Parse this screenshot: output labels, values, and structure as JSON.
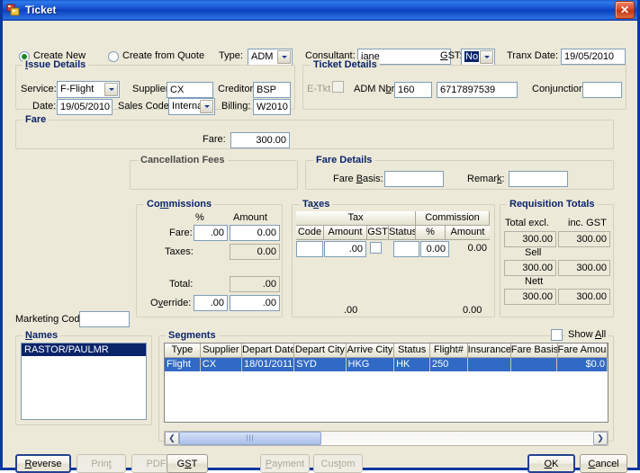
{
  "window": {
    "title": "Ticket",
    "icon": "ticket-icon",
    "close_label": "✕",
    "accent": "#0A37A0",
    "face": "#ECE9D8",
    "group_title_color": "#0A246A",
    "selection_color": "#316AC5"
  },
  "top": {
    "create_new": "Create New",
    "create_from_quote": "Create from Quote",
    "type_label": "Type:",
    "type_value": "ADM",
    "consultant_label": "Consultant:",
    "consultant_value": "jane",
    "gst_label": "GST:",
    "gst_value": "No",
    "tranx_date_label": "Tranx Date:",
    "tranx_date_value": "19/05/2010"
  },
  "issue_details": {
    "title": "Issue Details",
    "service_label": "Service:",
    "service_value": "F-Flight",
    "supplier_label": "Supplier:",
    "supplier_value": "CX",
    "creditor_label": "Creditor:",
    "creditor_value": "BSP",
    "date_label": "Date:",
    "date_value": "19/05/2010",
    "sales_code_label": "Sales Code:",
    "sales_code_value": "Internat",
    "billing_label": "Billing:",
    "billing_value": "W2010"
  },
  "ticket_details": {
    "title": "Ticket Details",
    "etkt_label": "E-Tkt",
    "etkt_checked": false,
    "adm_nbr_label": "ADM Nbr:",
    "adm_nbr_value": "160",
    "adm_nbr_value2": "6717897539",
    "conjunction_label": "Conjunction:",
    "conjunction_value": ""
  },
  "fare": {
    "title": "Fare",
    "fare_label": "Fare:",
    "fare_value": "300.00"
  },
  "cancellation_fees": {
    "title": "Cancellation Fees"
  },
  "fare_details": {
    "title": "Fare Details",
    "fare_basis_label": "Fare Basis:",
    "fare_basis_value": "",
    "remark_label": "Remark:",
    "remark_value": ""
  },
  "commissions": {
    "title": "Commissions",
    "col_pct": "%",
    "col_amount": "Amount",
    "fare_label": "Fare:",
    "fare_pct": ".00",
    "fare_amount": "0.00",
    "taxes_label": "Taxes:",
    "taxes_amount": "0.00",
    "total_label": "Total:",
    "total_amount": ".00",
    "override_label": "Override:",
    "override_pct": ".00",
    "override_amount": ".00"
  },
  "taxes": {
    "title": "Taxes",
    "group_tax": "Tax",
    "group_commission": "Commission",
    "col_code": "Code",
    "col_amount": "Amount",
    "col_gst": "GST",
    "col_status": "Status",
    "col_pct": "%",
    "col_comm_amount": "Amount",
    "row": {
      "code": "",
      "amount": ".00",
      "gst_checked": false,
      "status": "",
      "pct": "0.00",
      "comm_amount": "0.00"
    },
    "total_amount": ".00",
    "total_comm": "0.00"
  },
  "requisition_totals": {
    "title": "Requisition Totals",
    "col_excl": "Total excl.",
    "col_inc_gst": "inc. GST",
    "total_excl": "300.00",
    "total_inc": "300.00",
    "sell_label": "Sell",
    "sell_excl": "300.00",
    "sell_inc": "300.00",
    "nett_label": "Nett",
    "nett_excl": "300.00",
    "nett_inc": "300.00"
  },
  "marketing": {
    "label": "Marketing Code:",
    "value": ""
  },
  "names": {
    "title": "Names",
    "items": [
      {
        "text": "RASTOR/PAULMR",
        "selected": true
      }
    ]
  },
  "segments": {
    "title": "Segments",
    "show_all_label": "Show All",
    "show_all_checked": false,
    "columns": [
      "Type",
      "Supplier",
      "Depart Date",
      "Depart City",
      "Arrive City",
      "Status",
      "Flight#",
      "Insurance",
      "Fare Basis",
      "Fare Amount"
    ],
    "rows": [
      {
        "selected": true,
        "cells": [
          "Flight",
          "CX",
          "18/01/2011",
          "SYD",
          "HKG",
          "HK",
          "250",
          "",
          "",
          "$0.0"
        ]
      }
    ],
    "scroll_left_icon": "chevron-left-icon",
    "scroll_right_icon": "chevron-right-icon"
  },
  "buttons": {
    "reverse": {
      "label": "Reverse",
      "enabled": true,
      "default": true
    },
    "print": {
      "label": "Print",
      "enabled": false
    },
    "pdf": {
      "label": "PDF",
      "enabled": false
    },
    "gst": {
      "label": "GST",
      "enabled": true
    },
    "payment": {
      "label": "Payment",
      "enabled": false
    },
    "custom": {
      "label": "Custom",
      "enabled": false
    },
    "ok": {
      "label": "OK",
      "enabled": true,
      "default": true
    },
    "cancel": {
      "label": "Cancel",
      "enabled": true
    }
  }
}
